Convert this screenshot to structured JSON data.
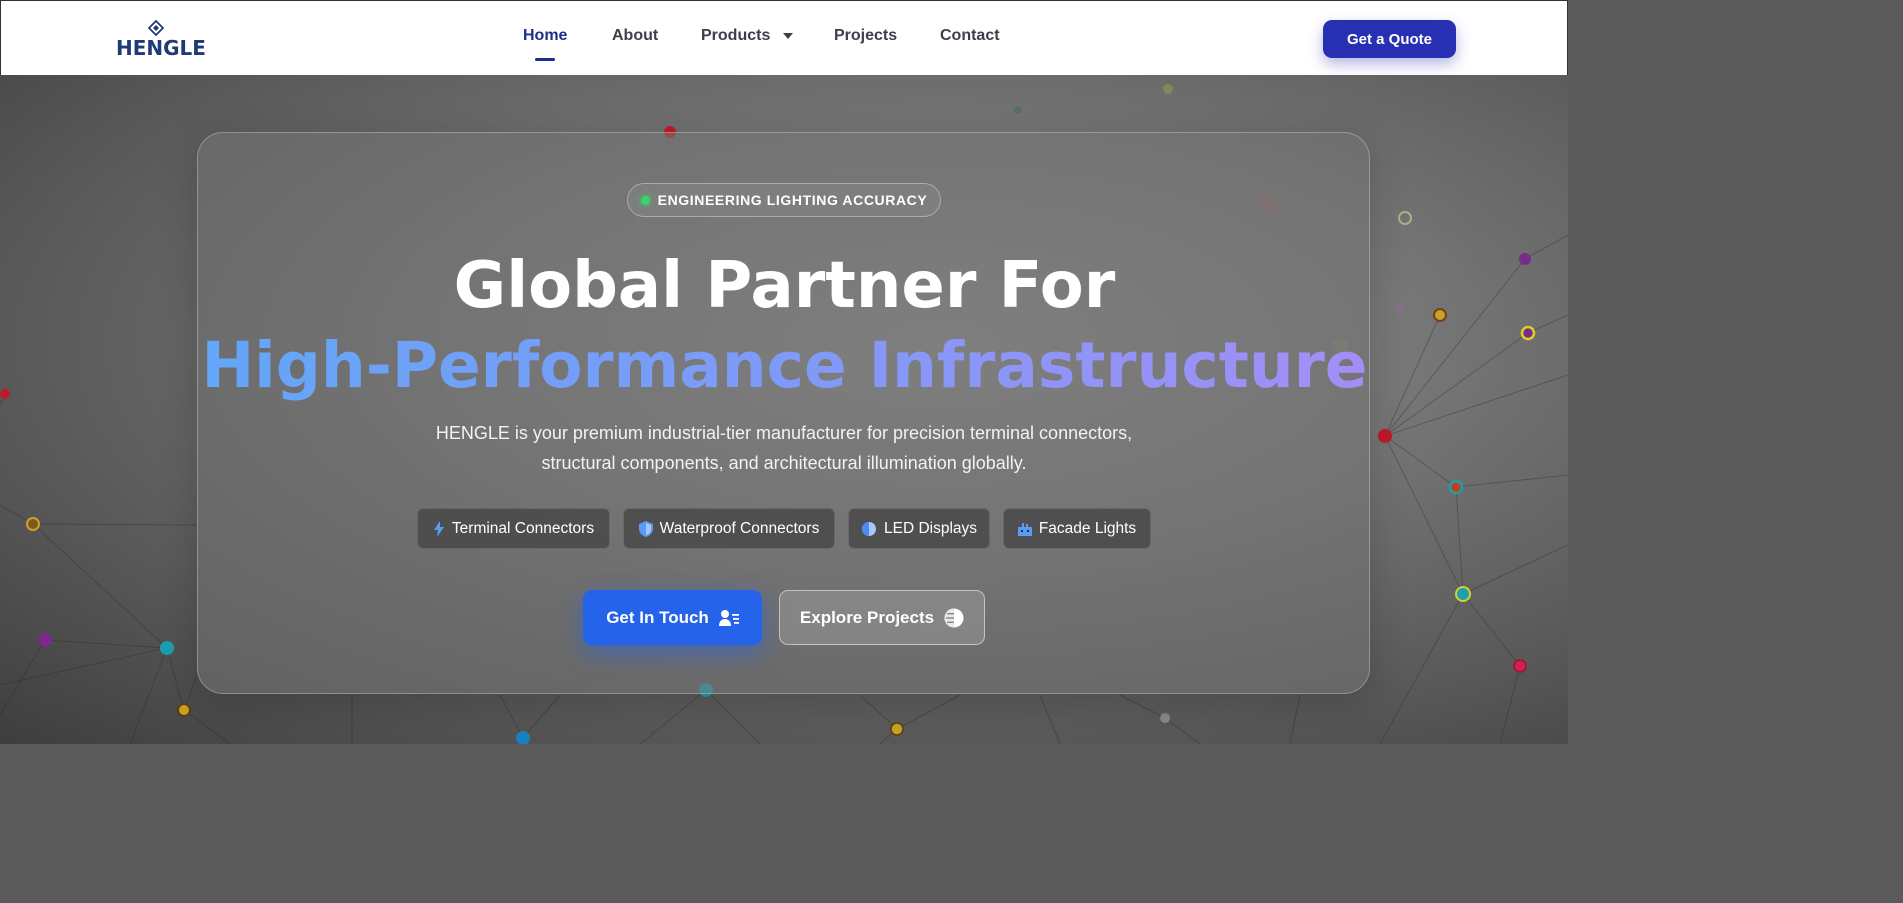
{
  "brand": {
    "name": "HENGLE",
    "color": "#1e3a78"
  },
  "nav": {
    "items": [
      {
        "label": "Home",
        "active": true
      },
      {
        "label": "About",
        "active": false
      },
      {
        "label": "Products",
        "active": false,
        "has_dropdown": true
      },
      {
        "label": "Projects",
        "active": false
      },
      {
        "label": "Contact",
        "active": false
      }
    ],
    "cta_label": "Get a Quote",
    "cta_color": "#2730b2"
  },
  "hero": {
    "badge": "ENGINEERING LIGHTING ACCURACY",
    "title_line1": "Global Partner For",
    "title_line2": "High-Performance Infrastructure",
    "subtitle_line1": "HENGLE is your premium industrial-tier manufacturer for precision terminal connectors,",
    "subtitle_line2": "structural components, and architectural illumination globally.",
    "chips": [
      {
        "label": "Terminal Connectors",
        "icon": "lightning-icon"
      },
      {
        "label": "Waterproof Connectors",
        "icon": "shield-icon"
      },
      {
        "label": "LED Displays",
        "icon": "half-circle-icon"
      },
      {
        "label": "Facade Lights",
        "icon": "building-icon"
      }
    ],
    "primary_button": {
      "label": "Get In Touch",
      "icon": "contact-card-icon",
      "color": "#2563eb"
    },
    "secondary_button": {
      "label": "Explore Projects",
      "icon": "globe-icon"
    }
  },
  "colors": {
    "accent_green": "#3ad46a",
    "gradient_start": "#63a6f7",
    "gradient_end": "#a38ef6"
  }
}
